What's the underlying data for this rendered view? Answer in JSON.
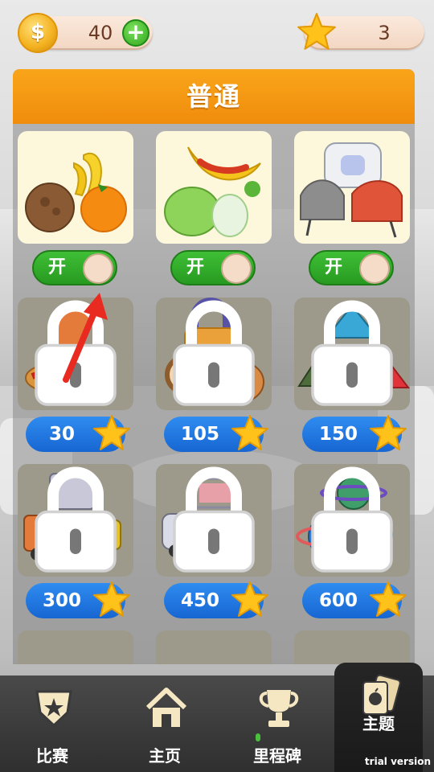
{
  "currency": {
    "coins": "40",
    "stars": "3",
    "coin_symbol": "$"
  },
  "panel": {
    "title": "普通"
  },
  "unlocked_items": [
    {
      "toggle_label": "开"
    },
    {
      "toggle_label": "开"
    },
    {
      "toggle_label": "开"
    }
  ],
  "locked_items": [
    {
      "price": "30"
    },
    {
      "price": "105"
    },
    {
      "price": "150"
    },
    {
      "price": "300"
    },
    {
      "price": "450"
    },
    {
      "price": "600"
    }
  ],
  "nav": {
    "items": [
      {
        "label": "比赛"
      },
      {
        "label": "主页"
      },
      {
        "label": "里程碑"
      },
      {
        "label": "主题"
      }
    ],
    "active_index": 3
  },
  "watermark": "trial version",
  "colors": {
    "header_orange": "#f59a12",
    "toggle_green": "#2fae26",
    "price_blue": "#1f78e2",
    "star_yellow": "#ffc21a"
  }
}
